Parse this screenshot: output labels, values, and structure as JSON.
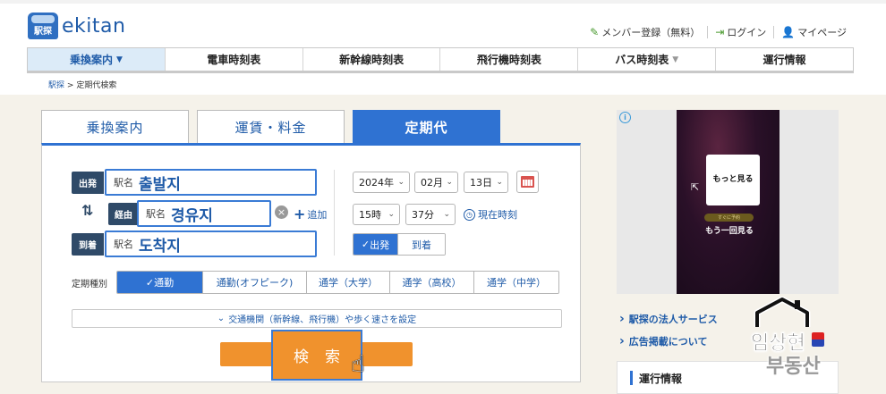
{
  "header": {
    "logo_text": "ekitan",
    "logo_badge": "駅探",
    "user_links": [
      {
        "label": "メンバー登録（無料）",
        "icon": "pencil-icon"
      },
      {
        "label": "ログイン",
        "icon": "login-icon"
      },
      {
        "label": "マイページ",
        "icon": "person-icon"
      }
    ]
  },
  "nav": {
    "items": [
      {
        "label": "乗換案内",
        "caret": "▼"
      },
      {
        "label": "電車時刻表"
      },
      {
        "label": "新幹線時刻表"
      },
      {
        "label": "飛行機時刻表"
      },
      {
        "label": "バス時刻表",
        "caret": "▼"
      },
      {
        "label": "運行情報"
      }
    ]
  },
  "breadcrumb": {
    "home": "駅探",
    "sep": ">",
    "current": "定期代検索"
  },
  "tabs": [
    "乗換案内",
    "運賃・料金",
    "定期代"
  ],
  "form": {
    "departure": {
      "label": "出発",
      "placeholder": "駅名",
      "value": "출발지"
    },
    "via": {
      "label": "経由",
      "placeholder": "駅名",
      "value": "경유지"
    },
    "arrival": {
      "label": "到着",
      "placeholder": "駅名",
      "value": "도착지"
    },
    "add_label": "追加",
    "swap_icon": "⇅",
    "date": {
      "year": "2024年",
      "month": "02月",
      "day": "13日"
    },
    "time": {
      "hour": "15時",
      "minute": "37分"
    },
    "now_label": "現在時刻",
    "dep_arr": {
      "options": [
        "出発",
        "到着"
      ],
      "selected": "出発"
    },
    "pass_type_label": "定期種別",
    "pass_types": [
      "通勤",
      "通勤(オフピーク)",
      "通学（大学）",
      "通学（高校）",
      "通学（中学）"
    ],
    "pass_selected": "通勤",
    "detail_label": "交通機関（新幹線、飛行機）や歩く速さを設定",
    "search_label": "検索"
  },
  "ad": {
    "card_text": "もっと見る",
    "pill_text": "すぐに予約",
    "replay_text": "もう一回見る"
  },
  "sidebar": {
    "links": [
      "駅探の法人サービス",
      "広告掲載について"
    ],
    "info_title": "運行情報"
  },
  "watermark": {
    "line1": "임상현",
    "line2": "부동산"
  },
  "colors": {
    "brand_blue": "#2f72d2",
    "nav_active_bg": "#dcebf8",
    "search_orange": "#f0922d",
    "label_navy": "#2f4a68"
  }
}
